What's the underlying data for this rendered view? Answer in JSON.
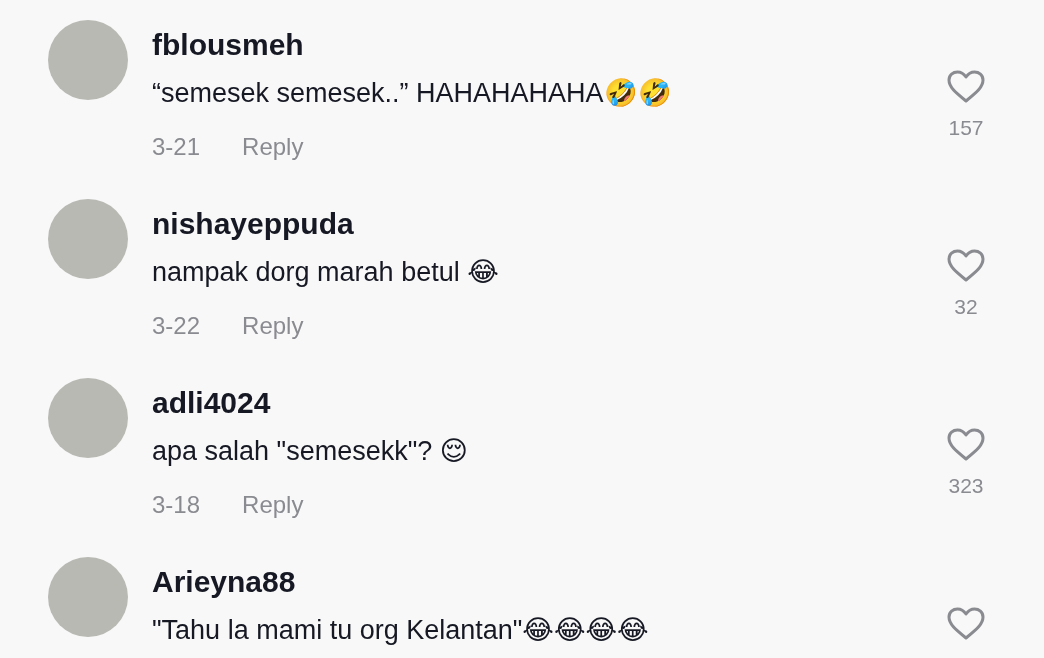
{
  "comments": [
    {
      "username": "fblousmeh",
      "text": "“semesek semesek..” HAHAHAHAHA🤣🤣",
      "date": "3-21",
      "reply": "Reply",
      "likes": "157"
    },
    {
      "username": "nishayeppuda",
      "text": "nampak dorg marah betul 😂",
      "date": "3-22",
      "reply": "Reply",
      "likes": "32"
    },
    {
      "username": "adli4024",
      "text": "apa salah \"semesekk\"? 😌",
      "date": "3-18",
      "reply": "Reply",
      "likes": "323"
    },
    {
      "username": "Arieyna88",
      "text": "\"Tahu la mami tu org Kelantan\"😂😂😂😂"
    }
  ]
}
